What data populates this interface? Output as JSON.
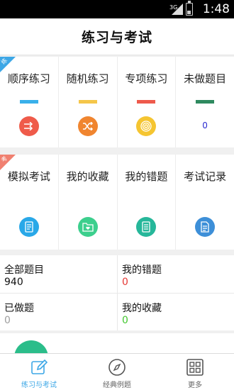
{
  "status_bar": {
    "network": "3G",
    "time": "1:48"
  },
  "header": {
    "title": "练习与考试"
  },
  "practice": {
    "ribbon": "练",
    "items": [
      {
        "label": "顺序练习",
        "bar_color": "#39b0ea",
        "icon": "sequence-arrows-icon",
        "icon_color": "#ef5b4a"
      },
      {
        "label": "随机练习",
        "bar_color": "#f5c64a",
        "icon": "shuffle-icon",
        "icon_color": "#f0852f"
      },
      {
        "label": "专项练习",
        "bar_color": "#ee5a4c",
        "icon": "target-icon",
        "icon_color": "#f5c531"
      },
      {
        "label": "未做题目",
        "bar_color": "#2f8a5f",
        "count": "0"
      }
    ]
  },
  "exam": {
    "ribbon": "考",
    "items": [
      {
        "label": "模拟考试",
        "icon": "exam-paper-icon",
        "icon_color": "#29a8e8"
      },
      {
        "label": "我的收藏",
        "icon": "favorites-folder-icon",
        "icon_color": "#3ccf8d"
      },
      {
        "label": "我的错题",
        "icon": "wrong-list-icon",
        "icon_color": "#26b79a"
      },
      {
        "label": "考试记录",
        "icon": "record-doc-icon",
        "icon_color": "#3d8fd8"
      }
    ]
  },
  "stats": {
    "all": {
      "label": "全部题目",
      "value": "940",
      "color": "#111111"
    },
    "wrong": {
      "label": "我的错题",
      "value": "0",
      "color": "#e53935"
    },
    "done": {
      "label": "已做题",
      "value": "0",
      "color": "#9e9e9e"
    },
    "fav": {
      "label": "我的收藏",
      "value": "0",
      "color": "#43c72f"
    }
  },
  "tabs": [
    {
      "label": "练习与考试",
      "icon": "edit-pencil-icon",
      "active": true
    },
    {
      "label": "经典例题",
      "icon": "compass-icon",
      "active": false
    },
    {
      "label": "更多",
      "icon": "grid-more-icon",
      "active": false
    }
  ]
}
